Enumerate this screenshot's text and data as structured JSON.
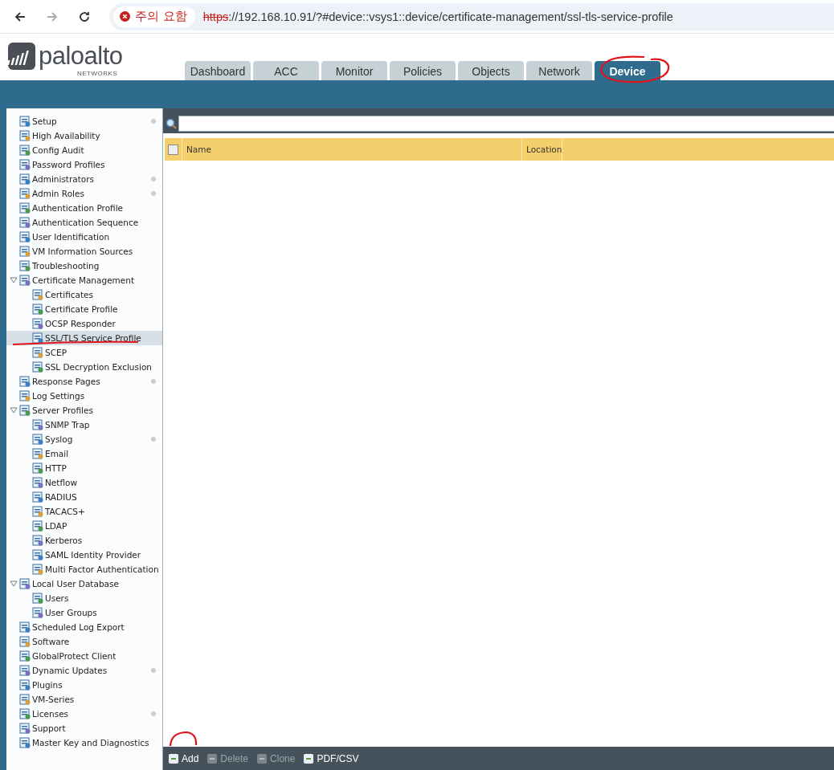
{
  "browser": {
    "security_chip": "주의 요함",
    "url_scheme": "https",
    "url_rest": "://192.168.10.91/?#device::vsys1::device/certificate-management/ssl-tls-service-profile"
  },
  "logo": {
    "wordmark": "paloalto",
    "subtitle": "NETWORKS"
  },
  "tabs": [
    {
      "label": "Dashboard",
      "selected": false
    },
    {
      "label": "ACC",
      "selected": false
    },
    {
      "label": "Monitor",
      "selected": false
    },
    {
      "label": "Policies",
      "selected": false
    },
    {
      "label": "Objects",
      "selected": false
    },
    {
      "label": "Network",
      "selected": false
    },
    {
      "label": "Device",
      "selected": true
    }
  ],
  "sidebar": {
    "items": [
      {
        "label": "Setup",
        "selected": false,
        "dot": true
      },
      {
        "label": "High Availability",
        "selected": false,
        "dot": false
      },
      {
        "label": "Config Audit",
        "selected": false,
        "dot": false
      },
      {
        "label": "Password Profiles",
        "selected": false,
        "dot": false
      },
      {
        "label": "Administrators",
        "selected": false,
        "dot": true
      },
      {
        "label": "Admin Roles",
        "selected": false,
        "dot": true
      },
      {
        "label": "Authentication Profile",
        "selected": false,
        "dot": false
      },
      {
        "label": "Authentication Sequence",
        "selected": false,
        "dot": false
      },
      {
        "label": "User Identification",
        "selected": false,
        "dot": false
      },
      {
        "label": "VM Information Sources",
        "selected": false,
        "dot": false
      },
      {
        "label": "Troubleshooting",
        "selected": false,
        "dot": false
      },
      {
        "label": "Certificate Management",
        "selected": false,
        "dot": false,
        "expanded": true,
        "children": [
          {
            "label": "Certificates",
            "selected": false,
            "dot": false
          },
          {
            "label": "Certificate Profile",
            "selected": false,
            "dot": false
          },
          {
            "label": "OCSP Responder",
            "selected": false,
            "dot": false
          },
          {
            "label": "SSL/TLS Service Profile",
            "selected": true,
            "dot": false
          },
          {
            "label": "SCEP",
            "selected": false,
            "dot": false
          },
          {
            "label": "SSL Decryption Exclusion",
            "selected": false,
            "dot": false
          }
        ]
      },
      {
        "label": "Response Pages",
        "selected": false,
        "dot": true
      },
      {
        "label": "Log Settings",
        "selected": false,
        "dot": false
      },
      {
        "label": "Server Profiles",
        "selected": false,
        "dot": false,
        "expanded": true,
        "children": [
          {
            "label": "SNMP Trap",
            "selected": false,
            "dot": false
          },
          {
            "label": "Syslog",
            "selected": false,
            "dot": true
          },
          {
            "label": "Email",
            "selected": false,
            "dot": false
          },
          {
            "label": "HTTP",
            "selected": false,
            "dot": false
          },
          {
            "label": "Netflow",
            "selected": false,
            "dot": false
          },
          {
            "label": "RADIUS",
            "selected": false,
            "dot": false
          },
          {
            "label": "TACACS+",
            "selected": false,
            "dot": false
          },
          {
            "label": "LDAP",
            "selected": false,
            "dot": false
          },
          {
            "label": "Kerberos",
            "selected": false,
            "dot": false
          },
          {
            "label": "SAML Identity Provider",
            "selected": false,
            "dot": false
          },
          {
            "label": "Multi Factor Authentication",
            "selected": false,
            "dot": false
          }
        ]
      },
      {
        "label": "Local User Database",
        "selected": false,
        "dot": false,
        "expanded": true,
        "children": [
          {
            "label": "Users",
            "selected": false,
            "dot": false
          },
          {
            "label": "User Groups",
            "selected": false,
            "dot": false
          }
        ]
      },
      {
        "label": "Scheduled Log Export",
        "selected": false,
        "dot": false
      },
      {
        "label": "Software",
        "selected": false,
        "dot": false
      },
      {
        "label": "GlobalProtect Client",
        "selected": false,
        "dot": false
      },
      {
        "label": "Dynamic Updates",
        "selected": false,
        "dot": true
      },
      {
        "label": "Plugins",
        "selected": false,
        "dot": false
      },
      {
        "label": "VM-Series",
        "selected": false,
        "dot": false
      },
      {
        "label": "Licenses",
        "selected": false,
        "dot": true
      },
      {
        "label": "Support",
        "selected": false,
        "dot": false
      },
      {
        "label": "Master Key and Diagnostics",
        "selected": false,
        "dot": false
      }
    ]
  },
  "table": {
    "select_all_checked": false,
    "columns": [
      "Name",
      "Location"
    ]
  },
  "toolbar": [
    {
      "label": "Add",
      "disabled": false
    },
    {
      "label": "Delete",
      "disabled": true
    },
    {
      "label": "Clone",
      "disabled": true
    },
    {
      "label": "PDF/CSV",
      "disabled": false
    }
  ]
}
